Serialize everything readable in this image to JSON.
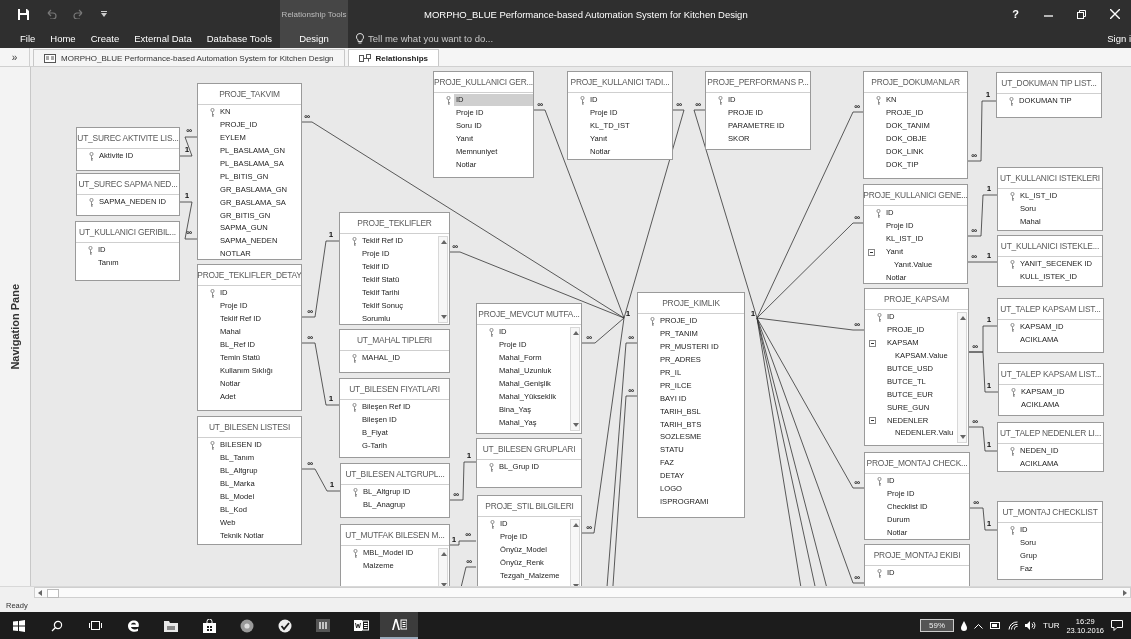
{
  "title_bar": {
    "context_label": "Relationship Tools",
    "title": "MORPHO_BLUE Performance-based Automation System for Kitchen Design",
    "help": "?"
  },
  "ribbon_tabs": [
    {
      "label": "File",
      "kind": "normal"
    },
    {
      "label": "Home",
      "kind": "normal"
    },
    {
      "label": "Create",
      "kind": "normal"
    },
    {
      "label": "External Data",
      "kind": "normal"
    },
    {
      "label": "Database Tools",
      "kind": "normal"
    },
    {
      "label": "Design",
      "kind": "contextual"
    }
  ],
  "tell_me": {
    "placeholder": "Tell me what you want to do..."
  },
  "sign_in": "Sign i",
  "document_tabs": [
    {
      "label": "MORPHO_BLUE Performance-based Automation System for Kitchen Design",
      "kind": "form",
      "selected": false
    },
    {
      "label": "Relationships",
      "kind": "relationships",
      "selected": true
    }
  ],
  "shutter_button": "»",
  "navigation_pane": {
    "label": "Navigation Pane"
  },
  "tables": [
    {
      "name": "PROJE_TAKVIM",
      "fields": [
        {
          "name": "KN",
          "kind": "key",
          "selected": false
        },
        {
          "name": "PROJE_ID",
          "kind": "field",
          "selected": false
        },
        {
          "name": "EYLEM",
          "kind": "field",
          "selected": false
        },
        {
          "name": "PL_BASLAMA_GN",
          "kind": "field",
          "selected": false
        },
        {
          "name": "PL_BASLAMA_SA",
          "kind": "field",
          "selected": false
        },
        {
          "name": "PL_BITIS_GN",
          "kind": "field",
          "selected": false
        },
        {
          "name": "GR_BASLAMA_GN",
          "kind": "field",
          "selected": false
        },
        {
          "name": "GR_BASLAMA_SA",
          "kind": "field",
          "selected": false
        },
        {
          "name": "GR_BITIS_GN",
          "kind": "field",
          "selected": false
        },
        {
          "name": "SAPMA_GUN",
          "kind": "field",
          "selected": false
        },
        {
          "name": "SAPMA_NEDEN",
          "kind": "field",
          "selected": false
        },
        {
          "name": "NOTLAR",
          "kind": "field",
          "selected": false
        }
      ]
    },
    {
      "name": "UT_SUREC AKTIVITE LIS...",
      "fields": [
        {
          "name": "Aktivite ID",
          "kind": "key",
          "selected": false
        }
      ]
    },
    {
      "name": "UT_SUREC SAPMA NED...",
      "fields": [
        {
          "name": "SAPMA_NEDEN ID",
          "kind": "key",
          "selected": false
        }
      ]
    },
    {
      "name": "UT_KULLANICI GERIBIL...",
      "fields": [
        {
          "name": "ID",
          "kind": "key",
          "selected": false
        },
        {
          "name": "Tanım",
          "kind": "field",
          "selected": false
        }
      ]
    },
    {
      "name": "PROJE_TEKLIFLER_DETAY",
      "fields": [
        {
          "name": "ID",
          "kind": "key",
          "selected": false
        },
        {
          "name": "Proje ID",
          "kind": "field",
          "selected": false
        },
        {
          "name": "Teklif Ref ID",
          "kind": "field",
          "selected": false
        },
        {
          "name": "Mahal",
          "kind": "field",
          "selected": false
        },
        {
          "name": "BL_Ref ID",
          "kind": "field",
          "selected": false
        },
        {
          "name": "Temin Statü",
          "kind": "field",
          "selected": false
        },
        {
          "name": "Kullanım Sıklığı",
          "kind": "field",
          "selected": false
        },
        {
          "name": "Notlar",
          "kind": "field",
          "selected": false
        },
        {
          "name": "Adet",
          "kind": "field",
          "selected": false
        }
      ]
    },
    {
      "name": "UT_BILESEN LISTESI",
      "fields": [
        {
          "name": "BILESEN ID",
          "kind": "key",
          "selected": false
        },
        {
          "name": "BL_Tanım",
          "kind": "field",
          "selected": false
        },
        {
          "name": "BL_Altgrup",
          "kind": "field",
          "selected": false
        },
        {
          "name": "BL_Marka",
          "kind": "field",
          "selected": false
        },
        {
          "name": "BL_Model",
          "kind": "field",
          "selected": false
        },
        {
          "name": "BL_Kod",
          "kind": "field",
          "selected": false
        },
        {
          "name": "Web",
          "kind": "field",
          "selected": false
        },
        {
          "name": "Teknik Notlar",
          "kind": "field",
          "selected": false
        }
      ]
    },
    {
      "name": "PROJE_TEKLIFLER",
      "scrollbar": true,
      "fields": [
        {
          "name": "Teklif Ref ID",
          "kind": "key",
          "selected": false
        },
        {
          "name": "Proje ID",
          "kind": "field",
          "selected": false
        },
        {
          "name": "Teklif ID",
          "kind": "field",
          "selected": false
        },
        {
          "name": "Teklif Statü",
          "kind": "field",
          "selected": false
        },
        {
          "name": "Teklif Tarihi",
          "kind": "field",
          "selected": false
        },
        {
          "name": "Teklif Sonuç",
          "kind": "field",
          "selected": false
        },
        {
          "name": "Sorumlu",
          "kind": "field",
          "selected": false
        }
      ]
    },
    {
      "name": "UT_MAHAL TIPLERI",
      "fields": [
        {
          "name": "MAHAL_ID",
          "kind": "key",
          "selected": false
        }
      ]
    },
    {
      "name": "UT_BILESEN FIYATLARI",
      "fields": [
        {
          "name": "Bileşen Ref ID",
          "kind": "key",
          "selected": false
        },
        {
          "name": "Bileşen ID",
          "kind": "field",
          "selected": false
        },
        {
          "name": "B_Fiyat",
          "kind": "field",
          "selected": false
        },
        {
          "name": "G-Tarih",
          "kind": "field",
          "selected": false
        }
      ]
    },
    {
      "name": "UT_BILESEN ALTGRUPL...",
      "fields": [
        {
          "name": "BL_Altgrup ID",
          "kind": "key",
          "selected": false
        },
        {
          "name": "BL_Anagrup",
          "kind": "field",
          "selected": false
        }
      ]
    },
    {
      "name": "UT_MUTFAK BILESEN M...",
      "scrollbar": true,
      "fields": [
        {
          "name": "MBL_Model ID",
          "kind": "key",
          "selected": false
        },
        {
          "name": "Malzeme",
          "kind": "field",
          "selected": false
        }
      ]
    },
    {
      "name": "PROJE_KULLANICI GER...",
      "fields": [
        {
          "name": "ID",
          "kind": "key",
          "selected": true
        },
        {
          "name": "Proje ID",
          "kind": "field",
          "selected": false
        },
        {
          "name": "Soru ID",
          "kind": "field",
          "selected": false
        },
        {
          "name": "Yanıt",
          "kind": "field",
          "selected": false
        },
        {
          "name": "Memnuniyet",
          "kind": "field",
          "selected": false
        },
        {
          "name": "Notlar",
          "kind": "field",
          "selected": false
        }
      ]
    },
    {
      "name": "PROJE_KULLANICI TADI...",
      "fields": [
        {
          "name": "ID",
          "kind": "key",
          "selected": false
        },
        {
          "name": "Proje ID",
          "kind": "field",
          "selected": false
        },
        {
          "name": "KL_TD_IST",
          "kind": "field",
          "selected": false
        },
        {
          "name": "Yanıt",
          "kind": "field",
          "selected": false
        },
        {
          "name": "Notlar",
          "kind": "field",
          "selected": false
        }
      ]
    },
    {
      "name": "PROJE_PERFORMANS P...",
      "fields": [
        {
          "name": "ID",
          "kind": "key",
          "selected": false
        },
        {
          "name": "PROJE ID",
          "kind": "field",
          "selected": false
        },
        {
          "name": "PARAMETRE ID",
          "kind": "field",
          "selected": false
        },
        {
          "name": "SKOR",
          "kind": "field",
          "selected": false
        }
      ]
    },
    {
      "name": "PROJE_MEVCUT MUTFA...",
      "scrollbar": true,
      "fields": [
        {
          "name": "ID",
          "kind": "key",
          "selected": false
        },
        {
          "name": "Proje ID",
          "kind": "field",
          "selected": false
        },
        {
          "name": "Mahal_Form",
          "kind": "field",
          "selected": false
        },
        {
          "name": "Mahal_Uzunluk",
          "kind": "field",
          "selected": false
        },
        {
          "name": "Mahal_Genişlik",
          "kind": "field",
          "selected": false
        },
        {
          "name": "Mahal_Yükseklik",
          "kind": "field",
          "selected": false
        },
        {
          "name": "Bina_Yaş",
          "kind": "field",
          "selected": false
        },
        {
          "name": "Mahal_Yaş",
          "kind": "field",
          "selected": false
        }
      ]
    },
    {
      "name": "UT_BILESEN GRUPLARI",
      "fields": [
        {
          "name": "BL_Grup ID",
          "kind": "key",
          "selected": false
        }
      ]
    },
    {
      "name": "PROJE_STIL BILGILERI",
      "scrollbar": true,
      "fields": [
        {
          "name": "ID",
          "kind": "key",
          "selected": false
        },
        {
          "name": "Proje ID",
          "kind": "field",
          "selected": false
        },
        {
          "name": "Önyüz_Model",
          "kind": "field",
          "selected": false
        },
        {
          "name": "Önyüz_Renk",
          "kind": "field",
          "selected": false
        },
        {
          "name": "Tezgah_Malzeme",
          "kind": "field",
          "selected": false
        }
      ]
    },
    {
      "name": "PROJE_KIMLIK",
      "fields": [
        {
          "name": "PROJE_ID",
          "kind": "key",
          "selected": false
        },
        {
          "name": "PR_TANIM",
          "kind": "field",
          "selected": false
        },
        {
          "name": "PR_MUSTERI ID",
          "kind": "field",
          "selected": false
        },
        {
          "name": "PR_ADRES",
          "kind": "field",
          "selected": false
        },
        {
          "name": "PR_IL",
          "kind": "field",
          "selected": false
        },
        {
          "name": "PR_ILCE",
          "kind": "field",
          "selected": false
        },
        {
          "name": "BAYI ID",
          "kind": "field",
          "selected": false
        },
        {
          "name": "TARIH_BSL",
          "kind": "field",
          "selected": false
        },
        {
          "name": "TARIH_BTS",
          "kind": "field",
          "selected": false
        },
        {
          "name": "SOZLESME",
          "kind": "field",
          "selected": false
        },
        {
          "name": "STATU",
          "kind": "field",
          "selected": false
        },
        {
          "name": "FAZ",
          "kind": "field",
          "selected": false
        },
        {
          "name": "DETAY",
          "kind": "field",
          "selected": false
        },
        {
          "name": "LOGO",
          "kind": "field",
          "selected": false
        },
        {
          "name": "ISPROGRAMI",
          "kind": "field",
          "selected": false
        }
      ]
    },
    {
      "name": "PROJE_DOKUMANLAR",
      "fields": [
        {
          "name": "KN",
          "kind": "key",
          "selected": false
        },
        {
          "name": "PROJE_ID",
          "kind": "field",
          "selected": false
        },
        {
          "name": "DOK_TANIM",
          "kind": "field",
          "selected": false
        },
        {
          "name": "DOK_OBJE",
          "kind": "field",
          "selected": false
        },
        {
          "name": "DOK_LINK",
          "kind": "field",
          "selected": false
        },
        {
          "name": "DOK_TIP",
          "kind": "field",
          "selected": false
        }
      ]
    },
    {
      "name": "UT_DOKUMAN TIP LIST...",
      "fields": [
        {
          "name": "DOKUMAN TIP",
          "kind": "key",
          "selected": false
        }
      ]
    },
    {
      "name": "UT_KULLANICI ISTEKLERI",
      "fields": [
        {
          "name": "KL_IST_ID",
          "kind": "key",
          "selected": false
        },
        {
          "name": "Soru",
          "kind": "field",
          "selected": false
        },
        {
          "name": "Mahal",
          "kind": "field",
          "selected": false
        }
      ]
    },
    {
      "name": "PROJE_KULLANICI GENE...",
      "fields": [
        {
          "name": "ID",
          "kind": "key",
          "selected": false
        },
        {
          "name": "Proje ID",
          "kind": "field",
          "selected": false
        },
        {
          "name": "KL_IST_ID",
          "kind": "field",
          "selected": false
        },
        {
          "name": "Yanıt",
          "kind": "group",
          "selected": false
        },
        {
          "name": "Yanıt.Value",
          "kind": "value",
          "selected": false
        },
        {
          "name": "Notlar",
          "kind": "field",
          "selected": false
        }
      ]
    },
    {
      "name": "UT_KULLANICI ISTEKLE...",
      "fields": [
        {
          "name": "YANIT_SECENEK ID",
          "kind": "key",
          "selected": false
        },
        {
          "name": "KULL_ISTEK_ID",
          "kind": "field",
          "selected": false
        }
      ]
    },
    {
      "name": "PROJE_KAPSAM",
      "scrollbar": true,
      "fields": [
        {
          "name": "ID",
          "kind": "key",
          "selected": false
        },
        {
          "name": "PROJE_ID",
          "kind": "field",
          "selected": false
        },
        {
          "name": "KAPSAM",
          "kind": "group",
          "selected": false
        },
        {
          "name": "KAPSAM.Value",
          "kind": "value",
          "selected": false
        },
        {
          "name": "BUTCE_USD",
          "kind": "field",
          "selected": false
        },
        {
          "name": "BUTCE_TL",
          "kind": "field",
          "selected": false
        },
        {
          "name": "BUTCE_EUR",
          "kind": "field",
          "selected": false
        },
        {
          "name": "SURE_GUN",
          "kind": "field",
          "selected": false
        },
        {
          "name": "NEDENLER",
          "kind": "group",
          "selected": false
        },
        {
          "name": "NEDENLER.Valu",
          "kind": "value",
          "selected": false
        }
      ]
    },
    {
      "name": "UT_TALEP KAPSAM LIST...",
      "fields": [
        {
          "name": "KAPSAM_ID",
          "kind": "key",
          "selected": false
        },
        {
          "name": "ACIKLAMA",
          "kind": "field",
          "selected": false
        }
      ]
    },
    {
      "name": "UT_TALEP KAPSAM LIST...",
      "fields": [
        {
          "name": "KAPSAM_ID",
          "kind": "key",
          "selected": false
        },
        {
          "name": "ACIKLAMA",
          "kind": "field",
          "selected": false
        }
      ]
    },
    {
      "name": "UT_TALEP NEDENLER LI...",
      "fields": [
        {
          "name": "NEDEN_ID",
          "kind": "key",
          "selected": false
        },
        {
          "name": "ACIKLAMA",
          "kind": "field",
          "selected": false
        }
      ]
    },
    {
      "name": "PROJE_MONTAJ CHECK...",
      "fields": [
        {
          "name": "ID",
          "kind": "key",
          "selected": false
        },
        {
          "name": "Proje ID",
          "kind": "field",
          "selected": false
        },
        {
          "name": "Checklist ID",
          "kind": "field",
          "selected": false
        },
        {
          "name": "Durum",
          "kind": "field",
          "selected": false
        },
        {
          "name": "Notlar",
          "kind": "field",
          "selected": false
        }
      ]
    },
    {
      "name": "UT_MONTAJ CHECKLIST",
      "fields": [
        {
          "name": "ID",
          "kind": "key",
          "selected": false
        },
        {
          "name": "Soru",
          "kind": "field",
          "selected": false
        },
        {
          "name": "Grup",
          "kind": "field",
          "selected": false
        },
        {
          "name": "Faz",
          "kind": "field",
          "selected": false
        }
      ]
    },
    {
      "name": "PROJE_MONTAJ EKIBI",
      "fields": [
        {
          "name": "ID",
          "kind": "key",
          "selected": false
        }
      ]
    }
  ],
  "relationships": [
    {
      "kind": "link",
      "ends": [
        "∞",
        "1"
      ]
    },
    {
      "kind": "link",
      "ends": [
        "∞"
      ]
    },
    {
      "kind": "link",
      "ends": [
        "∞"
      ]
    },
    {
      "kind": "link",
      "ends": [
        "∞"
      ]
    },
    {
      "kind": "link",
      "ends": [
        "∞"
      ]
    },
    {
      "kind": "link",
      "ends": [
        "∞"
      ]
    },
    {
      "kind": "link",
      "ends": [
        "∞"
      ]
    },
    {
      "kind": "link",
      "ends": [
        "∞"
      ]
    },
    {
      "kind": "link",
      "ends": [
        "∞"
      ]
    },
    {
      "kind": "link",
      "ends": [
        "∞",
        "1"
      ]
    },
    {
      "kind": "link",
      "ends": [
        "∞"
      ]
    },
    {
      "kind": "link",
      "ends": [
        "∞"
      ]
    },
    {
      "kind": "link",
      "ends": [
        "∞"
      ]
    },
    {
      "kind": "link",
      "ends": [
        "∞"
      ]
    },
    {
      "kind": "offscreen"
    },
    {
      "kind": "offscreen"
    },
    {
      "kind": "offscreen"
    },
    {
      "kind": "link",
      "ends": [
        "∞",
        "1"
      ]
    },
    {
      "kind": "link",
      "ends": [
        "1",
        "∞"
      ]
    },
    {
      "kind": "link",
      "ends": [
        "∞",
        "1"
      ]
    },
    {
      "kind": "link",
      "ends": [
        "∞",
        "1"
      ]
    },
    {
      "kind": "link",
      "ends": [
        "∞",
        "1"
      ]
    },
    {
      "kind": "link",
      "ends": [
        "∞",
        "1"
      ]
    },
    {
      "kind": "link",
      "ends": [
        "1",
        "∞"
      ]
    },
    {
      "kind": "link",
      "ends": [
        "∞"
      ]
    },
    {
      "kind": "link",
      "ends": [
        "∞",
        "1"
      ]
    },
    {
      "kind": "link",
      "ends": [
        "∞",
        "1"
      ]
    },
    {
      "kind": "link",
      "ends": [
        "∞",
        "1"
      ]
    },
    {
      "kind": "link",
      "ends": [
        "∞",
        "1"
      ]
    },
    {
      "kind": "link",
      "ends": [
        "1"
      ]
    },
    {
      "kind": "link",
      "ends": [
        "∞",
        "1"
      ]
    },
    {
      "kind": "link",
      "ends": [
        "∞",
        "1"
      ]
    }
  ],
  "status_bar": {
    "text": "Ready"
  },
  "taskbar": {
    "apps": [
      {
        "kind": "start",
        "active": false
      },
      {
        "kind": "search",
        "active": false
      },
      {
        "kind": "taskview",
        "active": false
      },
      {
        "kind": "browser",
        "active": false
      },
      {
        "kind": "folder",
        "active": false
      },
      {
        "kind": "store",
        "active": false
      },
      {
        "kind": "circle",
        "active": false
      },
      {
        "kind": "check",
        "active": false
      },
      {
        "kind": "bars",
        "active": false
      },
      {
        "kind": "word",
        "active": false
      },
      {
        "kind": "access",
        "active": true
      }
    ],
    "battery_label": "59%",
    "language": "TUR",
    "time": "16:29",
    "date": "23.10.2016"
  }
}
